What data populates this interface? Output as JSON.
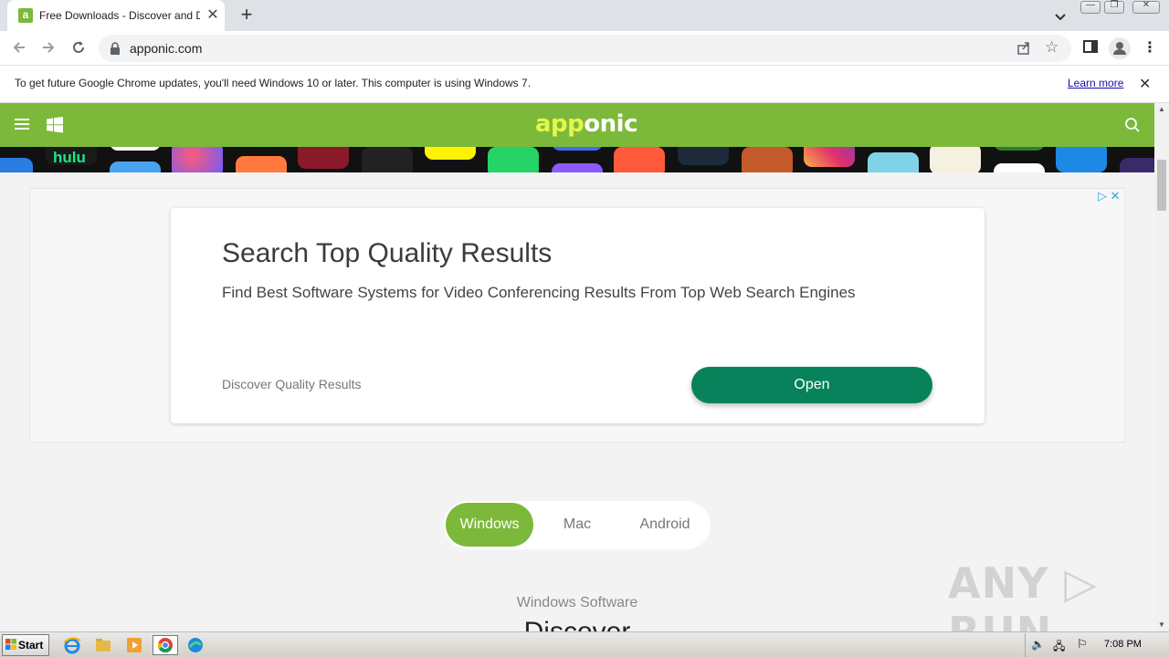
{
  "browser": {
    "tab": {
      "favicon_letter": "a",
      "title": "Free Downloads - Discover and Download Apps"
    },
    "new_tab_label": "+",
    "address": {
      "url": "apponic.com"
    }
  },
  "infobar": {
    "message": "To get future Google Chrome updates, you'll need Windows 10 or later. This computer is using Windows 7.",
    "link": "Learn more"
  },
  "site": {
    "logo_highlight": "app",
    "logo_rest": "onic",
    "brand_color": "#7cb93a"
  },
  "ad": {
    "headline": "Search Top Quality Results",
    "description": "Find Best Software Systems for Video Conferencing Results From Top Web Search Engines",
    "display": "Discover Quality Results",
    "button": "Open",
    "button_color": "#07825b"
  },
  "platforms": {
    "items": [
      "Windows",
      "Mac",
      "Android"
    ],
    "selected": "Windows"
  },
  "section": {
    "label": "Windows Software",
    "heading": "Discover"
  },
  "watermark": "ANY ▷ RUN",
  "taskbar": {
    "start_label": "Start",
    "clock": "7:08 PM"
  }
}
